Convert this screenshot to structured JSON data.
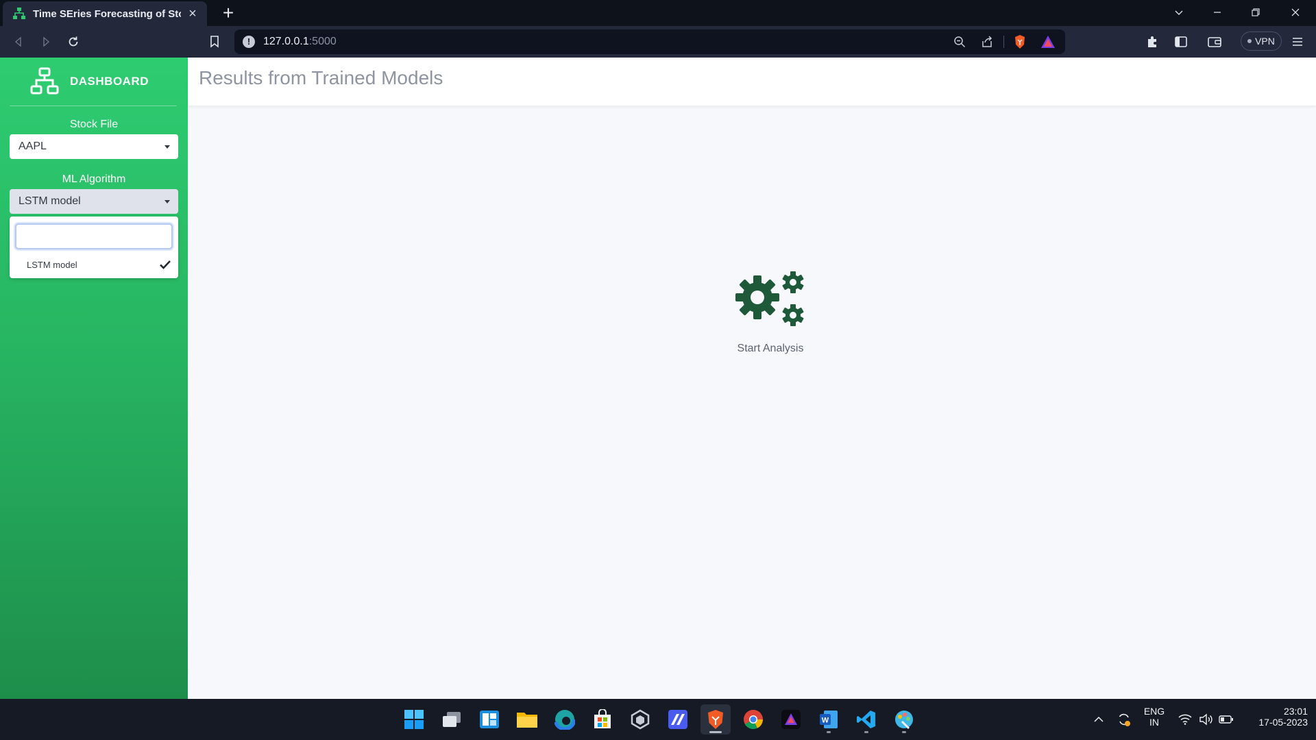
{
  "browser": {
    "tab_title": "Time SEries Forecasting of Stock F",
    "url_host": "127.0.0.1",
    "url_port": ":5000",
    "vpn_label": "VPN"
  },
  "sidebar": {
    "brand": "DASHBOARD",
    "stock_file_label": "Stock File",
    "stock_file_value": "AAPL",
    "ml_algorithm_label": "ML Algorithm",
    "ml_algorithm_value": "LSTM model",
    "dropdown_search_value": "",
    "dropdown_options": [
      {
        "label": "LSTM model",
        "selected": true
      }
    ]
  },
  "main": {
    "title": "Results from Trained Models",
    "empty_state_label": "Start Analysis"
  },
  "taskbar": {
    "language_top": "ENG",
    "language_bottom": "IN",
    "time": "23:01",
    "date": "17-05-2023"
  },
  "colors": {
    "sidebar_green": "#2ecc71",
    "gear_green": "#1e5a3a",
    "title_gray": "#8e94a0"
  }
}
